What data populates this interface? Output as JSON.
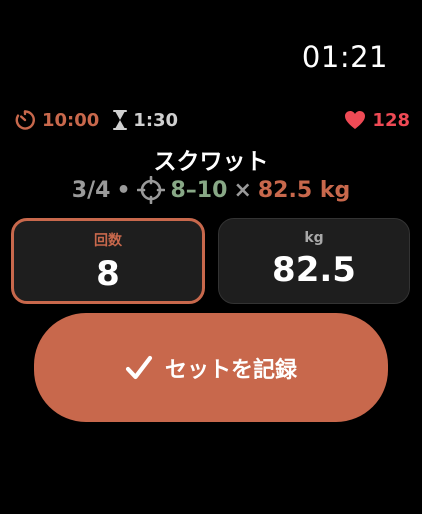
{
  "clock": {
    "time": "01:21"
  },
  "status": {
    "rest_timer": "10:00",
    "set_timer": "1:30",
    "heart_rate": "128",
    "icons": {
      "rest": "stopwatch-icon",
      "set": "hourglass-icon",
      "heart": "heart-icon"
    }
  },
  "exercise": {
    "name": "スクワット",
    "set_progress": "3/4",
    "separator": "•",
    "target_reps": "8–10",
    "times": "×",
    "target_weight": "82.5 kg",
    "target_icon": "crosshair-icon"
  },
  "fields": {
    "reps": {
      "label": "回数",
      "value": "8"
    },
    "weight": {
      "label": "kg",
      "value": "82.5"
    }
  },
  "record_button": {
    "label": "セットを記録",
    "icon": "checkmark-icon"
  },
  "colors": {
    "accent": "#c8684c",
    "target_green": "#88a886",
    "heart_red": "#ef4a55",
    "field_bg": "#1e1e1e",
    "background": "#000000"
  }
}
